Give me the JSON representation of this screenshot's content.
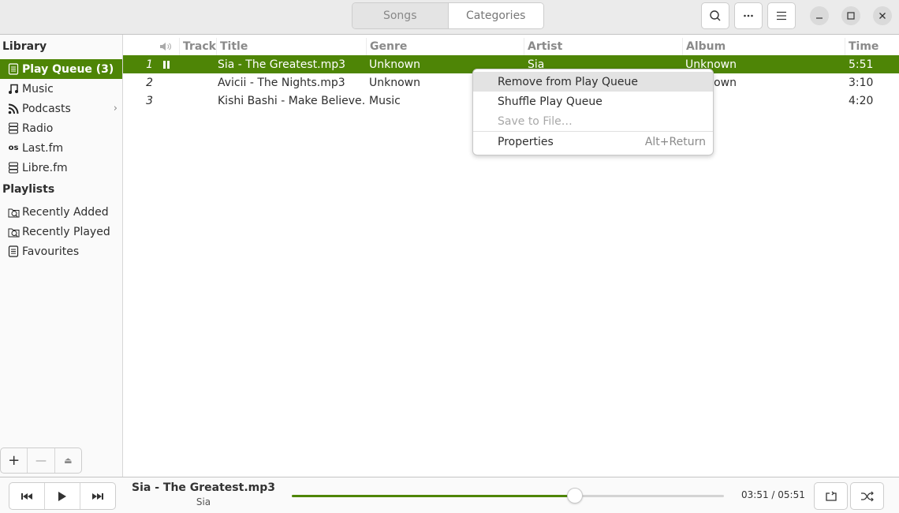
{
  "header": {
    "view_tabs": [
      {
        "label": "Songs",
        "active": false
      },
      {
        "label": "Categories",
        "active": true
      }
    ],
    "icons": [
      "search-icon",
      "more-icon",
      "menu-icon"
    ],
    "window_controls": [
      "minimize-icon",
      "maximize-icon",
      "close-icon"
    ]
  },
  "sidebar": {
    "library_heading": "Library",
    "library_items": [
      {
        "label": "Play Queue (3)",
        "icon": "document-icon",
        "active": true
      },
      {
        "label": "Music",
        "icon": "music-note-icon"
      },
      {
        "label": "Podcasts",
        "icon": "rss-icon",
        "has_children": true
      },
      {
        "label": "Radio",
        "icon": "server-icon"
      },
      {
        "label": "Last.fm",
        "icon": "lastfm-icon"
      },
      {
        "label": "Libre.fm",
        "icon": "server-icon"
      }
    ],
    "playlists_heading": "Playlists",
    "playlist_items": [
      {
        "label": "Recently Added",
        "icon": "smart-folder-icon"
      },
      {
        "label": "Recently Played",
        "icon": "smart-folder-icon"
      },
      {
        "label": "Favourites",
        "icon": "document-icon"
      }
    ],
    "tools": [
      "add-icon",
      "remove-icon",
      "eject-icon"
    ]
  },
  "table": {
    "columns": [
      "",
      "Track",
      "Title",
      "Genre",
      "Artist",
      "Album",
      "Time"
    ],
    "rows": [
      {
        "track": "1",
        "title": "Sia - The Greatest.mp3",
        "genre": "Unknown",
        "artist": "Sia",
        "album": "Unknown",
        "time": "5:51",
        "playing": true
      },
      {
        "track": "2",
        "title": "Avicii - The Nights.mp3",
        "genre": "Unknown",
        "artist": "",
        "album": "Unknown",
        "time": "3:10"
      },
      {
        "track": "3",
        "title": "Kishi Bashi - Make Believe…",
        "genre": "Music",
        "artist": "",
        "album": "",
        "time": "4:20"
      }
    ]
  },
  "context_menu": {
    "items": [
      {
        "label": "Remove from Play Queue",
        "highlighted": true
      },
      {
        "label": "Shuffle Play Queue"
      },
      {
        "label": "Save to File…",
        "disabled": true
      },
      {
        "label": "Properties",
        "accel": "Alt+Return"
      }
    ]
  },
  "player": {
    "title": "Sia - The Greatest.mp3",
    "artist": "Sia",
    "time_text": "03:51 / 05:51",
    "progress_fraction": 0.656,
    "accent_color": "#4e8506"
  }
}
